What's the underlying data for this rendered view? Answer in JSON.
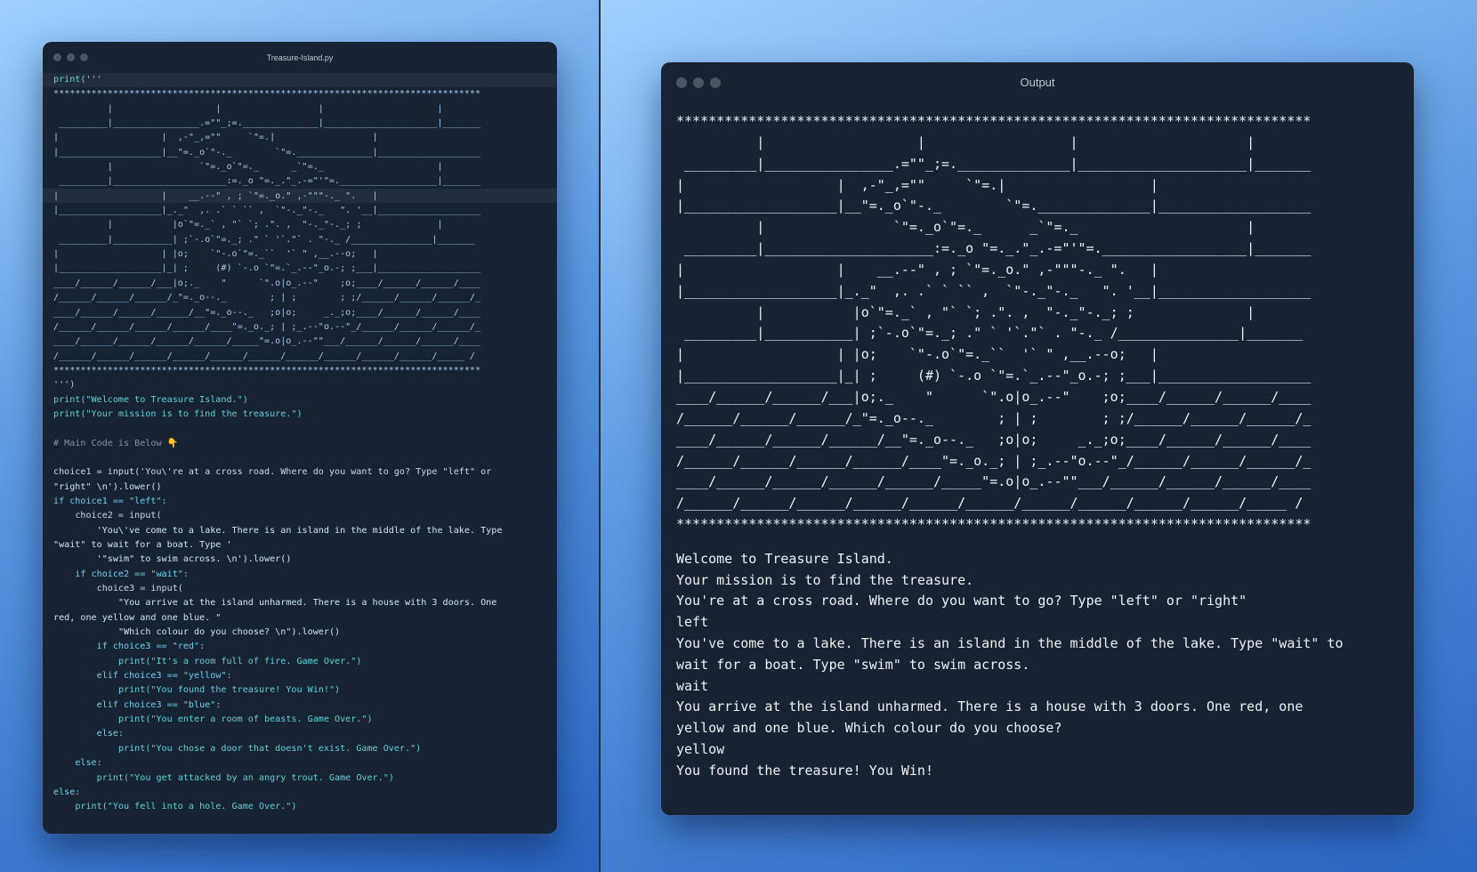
{
  "editor": {
    "title": "Treasure-Island.py",
    "art": "*******************************************************************************\n          |                   |                  |                     |\n _________|________________.=\"\"_;=.______________|_____________________|_______\n|                   |  ,-\"_,=\"\"     `\"=.|                  |\n|___________________|__\"=._o`\"-._        `\"=.______________|___________________\n          |                `\"=._o`\"=._      _`\"=._                     |\n _________|_____________________:=._o \"=._.\"_.-=\"'\"=.__________________|_______\n|                   |    __.--\" , ; `\"=._o.\" ,-\"\"\"-._ \".   |\n|___________________|_._\"  ,. .` ` `` ,  `\"-._\"-._   \". '__|___________________\n          |           |o`\"=._` , \"` `; .\". ,  \"-._\"-._; ;              |\n _________|___________| ;`-.o`\"=._; .\" ` '`.\"` . \"-._ /_______________|_______\n|                   | |o;    `\"-.o`\"=._``  '` \" ,__.--o;   |\n|___________________|_| ;     (#) `-.o `\"=.`_.--\"_o.-; ;___|___________________\n____/______/______/___|o;._    \"      `\".o|o_.--\"    ;o;____/______/______/____\n/______/______/______/_\"=._o--._        ; | ;        ; ;/______/______/______/_\n____/______/______/______/__\"=._o--._   ;o|o;     _._;o;____/______/______/____\n/______/______/______/______/____\"=._o._; | ;_.--\"o.--\"_/______/______/______/_\n____/______/______/______/______/_____\"=.o|o_.--\"\"___/______/______/______/____\n/______/______/______/______/______/______/______/______/______/______/_____ /\n*******************************************************************************"
  },
  "output": {
    "title": "Output",
    "art": "*******************************************************************************\n          |                   |                  |                     |\n _________|________________.=\"\"_;=.______________|_____________________|_______\n|                   |  ,-\"_,=\"\"     `\"=.|                  |\n|___________________|__\"=._o`\"-._        `\"=.______________|___________________\n          |                `\"=._o`\"=._      _`\"=._                     |\n _________|_____________________:=._o \"=._.\"_.-=\"'\"=.__________________|_______\n|                   |    __.--\" , ; `\"=._o.\" ,-\"\"\"-._ \".   |\n|___________________|_._\"  ,. .` ` `` ,  `\"-._\"-._   \". '__|___________________\n          |           |o`\"=._` , \"` `; .\". ,  \"-._\"-._; ;              |\n _________|___________| ;`-.o`\"=._; .\" ` '`.\"` . \"-._ /_______________|_______\n|                   | |o;    `\"-.o`\"=._``  '` \" ,__.--o;   |\n|___________________|_| ;     (#) `-.o `\"=.`_.--\"_o.-; ;___|___________________\n____/______/______/___|o;._    \"      `\".o|o_.--\"    ;o;____/______/______/____\n/______/______/______/_\"=._o--._        ; | ;        ; ;/______/______/______/_\n____/______/______/______/__\"=._o--._   ;o|o;     _._;o;____/______/______/____\n/______/______/______/______/____\"=._o._; | ;_.--\"o.--\"_/______/______/______/_\n____/______/______/______/______/_____\"=.o|o_.--\"\"___/______/______/______/____\n/______/______/______/______/______/______/______/______/______/______/_____ /\n*******************************************************************************",
    "text": "Welcome to Treasure Island.\nYour mission is to find the treasure.\nYou're at a cross road. Where do you want to go? Type \"left\" or \"right\"\nleft\nYou've come to a lake. There is an island in the middle of the lake. Type \"wait\" to\nwait for a boat. Type \"swim\" to swim across.\nwait\nYou arrive at the island unharmed. There is a house with 3 doors. One red, one\nyellow and one blue. Which colour do you choose?\nyellow\nYou found the treasure! You Win!"
  },
  "code": {
    "print_open": "print('''",
    "close_quote": "''')",
    "welcome": "print(\"Welcome to Treasure Island.\")",
    "mission": "print(\"Your mission is to find the treasure.\")",
    "comment": "# Main Code is Below 👇",
    "l1": "choice1 = input('You\\'re at a cross road. Where do you want to go? Type \"left\" or",
    "l2": "\"right\" \\n').lower()",
    "l3": "if choice1 == \"left\":",
    "l4": "    choice2 = input(",
    "l5": "        'You\\'ve come to a lake. There is an island in the middle of the lake. Type",
    "l6": "\"wait\" to wait for a boat. Type '",
    "l7": "        '\"swim\" to swim across. \\n').lower()",
    "l8": "    if choice2 == \"wait\":",
    "l9": "        choice3 = input(",
    "l10": "            \"You arrive at the island unharmed. There is a house with 3 doors. One",
    "l11": "red, one yellow and one blue. \"",
    "l12": "            \"Which colour do you choose? \\n\").lower()",
    "l13": "        if choice3 == \"red\":",
    "l14": "            print(\"It's a room full of fire. Game Over.\")",
    "l15": "        elif choice3 == \"yellow\":",
    "l16": "            print(\"You found the treasure! You Win!\")",
    "l17": "        elif choice3 == \"blue\":",
    "l18": "            print(\"You enter a room of beasts. Game Over.\")",
    "l19": "        else:",
    "l20": "            print(\"You chose a door that doesn't exist. Game Over.\")",
    "l21": "    else:",
    "l22": "        print(\"You get attacked by an angry trout. Game Over.\")",
    "l23": "else:",
    "l24": "    print(\"You fell into a hole. Game Over.\")"
  }
}
